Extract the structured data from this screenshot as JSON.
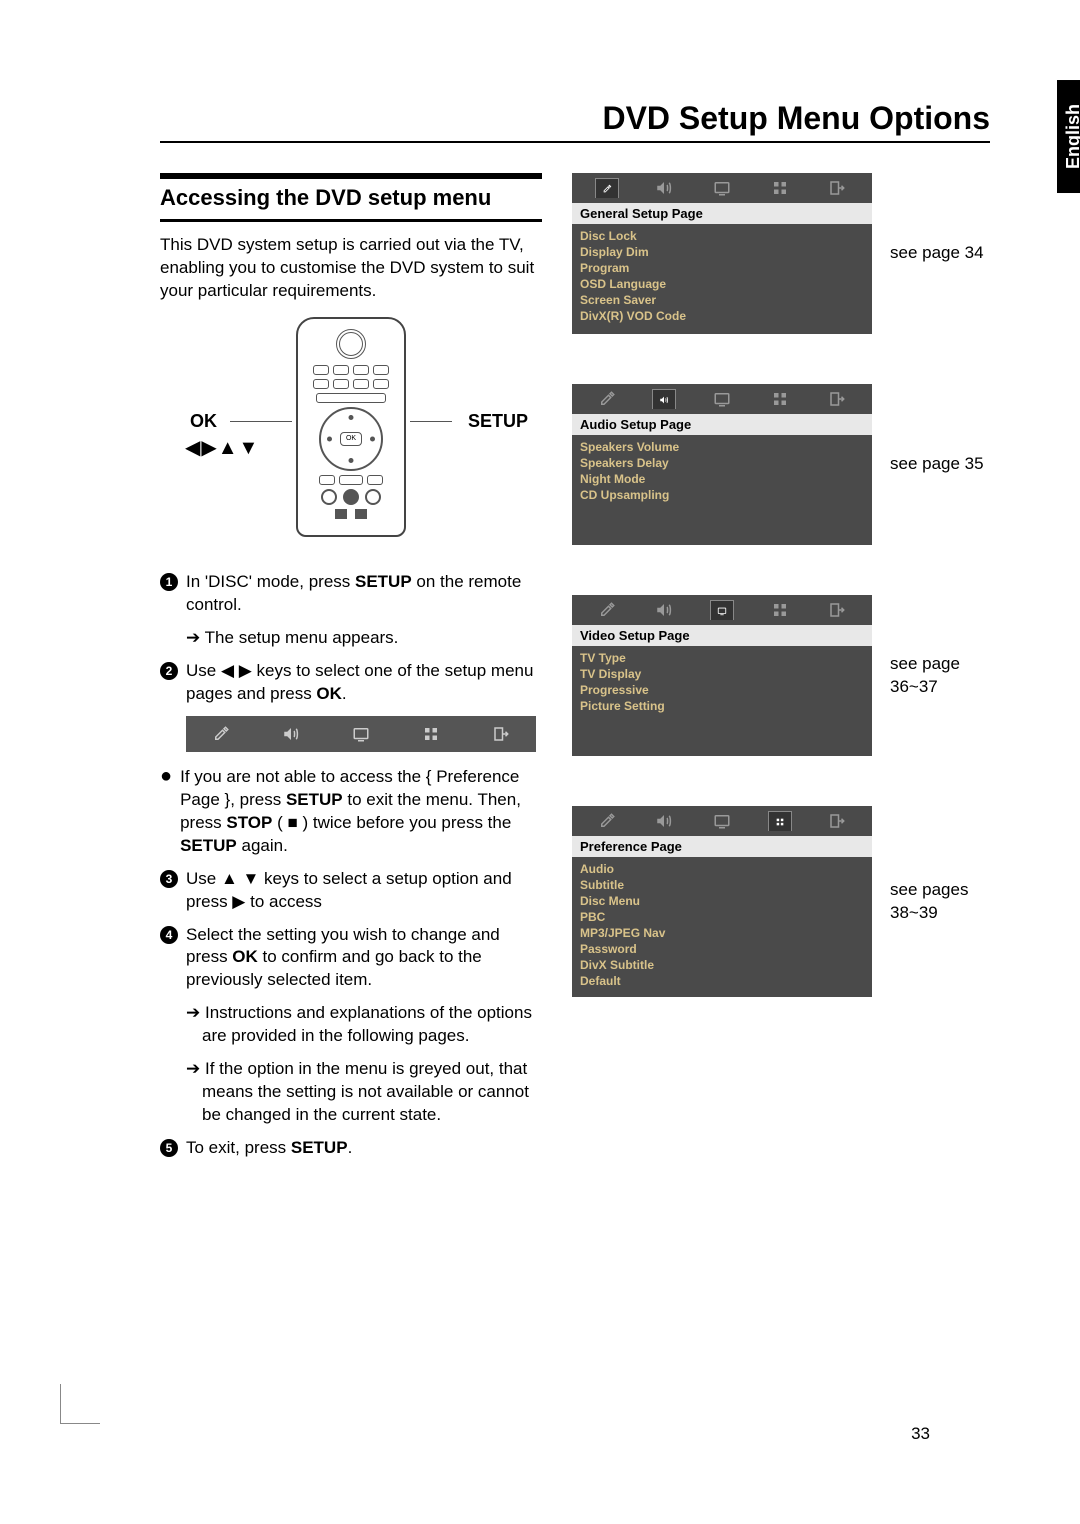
{
  "page_title": "DVD Setup Menu Options",
  "section_title": "Accessing the DVD setup menu",
  "intro_text": "This DVD system setup is carried out via the TV, enabling you to customise the DVD system to suit your particular requirements.",
  "remote_labels": {
    "ok": "OK",
    "setup": "SETUP",
    "arrows": "◀▶▲▼"
  },
  "steps": {
    "s1_a": "In 'DISC' mode, press ",
    "s1_b": "SETUP",
    "s1_c": " on the remote control.",
    "s1_sub": "The setup menu appears.",
    "s2_a": "Use ◀ ▶ keys to select one of the setup menu pages and press ",
    "s2_b": "OK",
    "s2_c": ".",
    "bullet_a": "If you are not able to access the { Preference Page }, press ",
    "bullet_b": "SETUP",
    "bullet_c": " to exit the menu.  Then, press ",
    "bullet_d": "STOP",
    "bullet_e": " ( ■ ) twice before you press the ",
    "bullet_f": "SETUP",
    "bullet_g": " again.",
    "s3": "Use ▲ ▼ keys to select a setup option and press ▶ to access",
    "s4_a": "Select the setting you wish to change and press ",
    "s4_b": "OK",
    "s4_c": " to confirm and go back to the previously selected item.",
    "s4_sub1": "Instructions and explanations of the options are provided in the following pages.",
    "s4_sub2": "If the option in the menu is greyed out, that means the setting is not available or cannot be changed in the current state.",
    "s5_a": "To exit, press ",
    "s5_b": "SETUP",
    "s5_c": "."
  },
  "menus": [
    {
      "header": "General Setup Page",
      "items": [
        "Disc Lock",
        "Display Dim",
        "Program",
        "OSD Language",
        "Screen Saver",
        "DivX(R) VOD Code"
      ],
      "active_tab": 0,
      "ref": "see page 34"
    },
    {
      "header": "Audio Setup Page",
      "items": [
        "Speakers Volume",
        "Speakers Delay",
        "Night Mode",
        "CD Upsampling"
      ],
      "active_tab": 1,
      "ref": "see page 35"
    },
    {
      "header": "Video Setup Page",
      "items": [
        "TV Type",
        "TV Display",
        "Progressive",
        "Picture Setting"
      ],
      "active_tab": 2,
      "ref": "see page 36~37"
    },
    {
      "header": "Preference Page",
      "items": [
        "Audio",
        "Subtitle",
        "Disc Menu",
        "PBC",
        "MP3/JPEG Nav",
        "Password",
        "DivX Subtitle",
        "Default"
      ],
      "active_tab": 3,
      "ref": "see pages 38~39"
    }
  ],
  "language_tab": "English",
  "page_number": "33"
}
